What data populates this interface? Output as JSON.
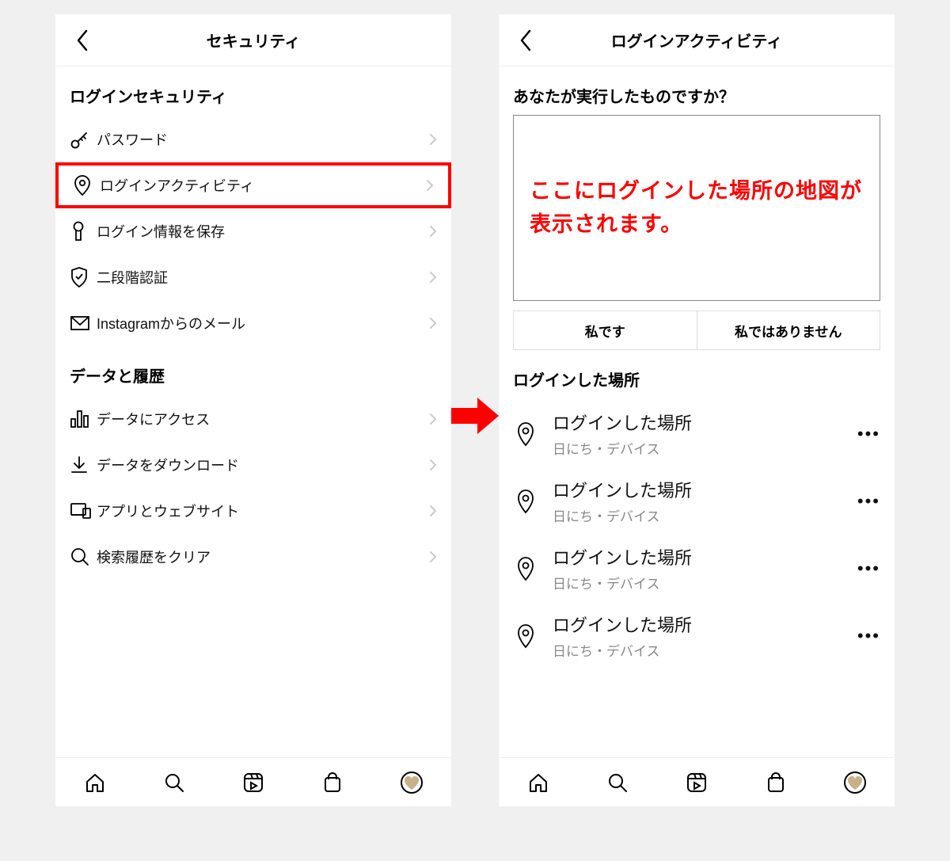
{
  "left": {
    "title": "セキュリティ",
    "section1_title": "ログインセキュリティ",
    "rows1": [
      {
        "label": "パスワード"
      },
      {
        "label": "ログインアクティビティ"
      },
      {
        "label": "ログイン情報を保存"
      },
      {
        "label": "二段階認証"
      },
      {
        "label": "Instagramからのメール"
      }
    ],
    "section2_title": "データと履歴",
    "rows2": [
      {
        "label": "データにアクセス"
      },
      {
        "label": "データをダウンロード"
      },
      {
        "label": "アプリとウェブサイト"
      },
      {
        "label": "検索履歴をクリア"
      }
    ]
  },
  "right": {
    "title": "ログインアクティビティ",
    "prompt": "あなたが実行したものですか？",
    "map_placeholder": "ここにログインした場所の地図が表示されます。",
    "btn_yes": "私です",
    "btn_no": "私ではありません",
    "list_title": "ログインした場所",
    "items": [
      {
        "main": "ログインした場所",
        "sub": "日にち・デバイス"
      },
      {
        "main": "ログインした場所",
        "sub": "日にち・デバイス"
      },
      {
        "main": "ログインした場所",
        "sub": "日にち・デバイス"
      },
      {
        "main": "ログインした場所",
        "sub": "日にち・デバイス"
      }
    ]
  }
}
